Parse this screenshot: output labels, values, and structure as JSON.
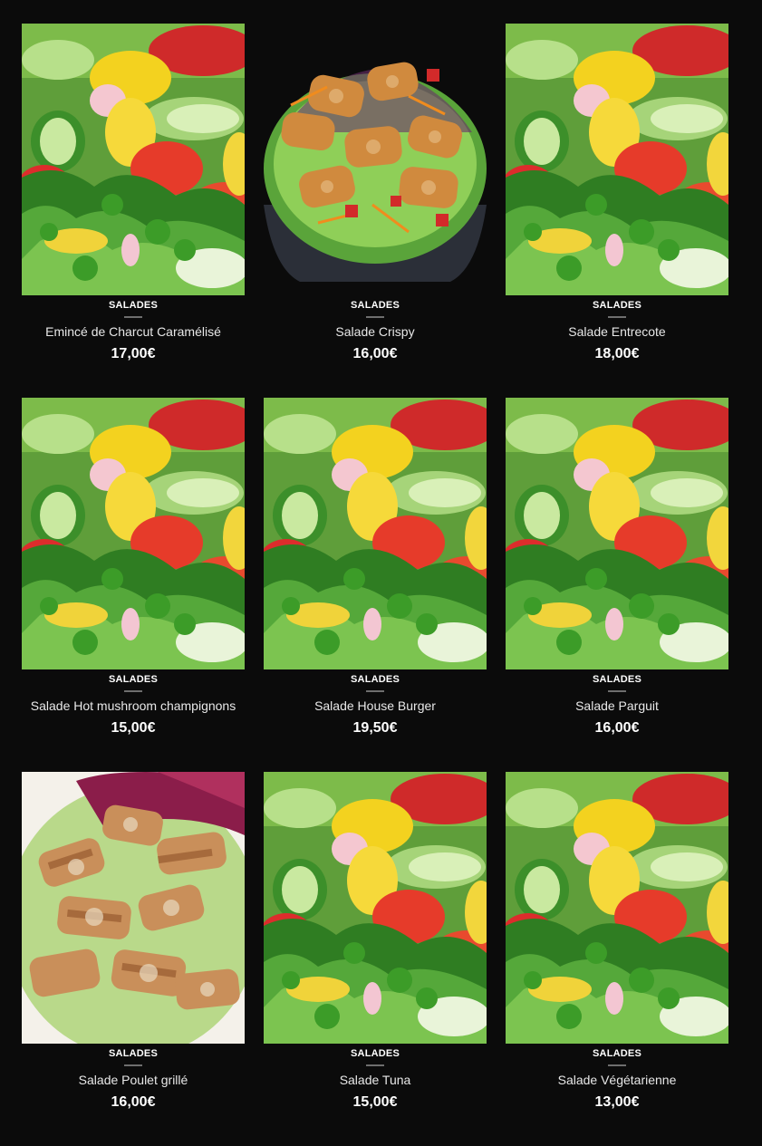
{
  "products": [
    {
      "category": "SALADES",
      "name": "Emincé de Charcut Caramélisé",
      "price": "17,00€",
      "image": "mixed-salad"
    },
    {
      "category": "SALADES",
      "name": "Salade Crispy",
      "price": "16,00€",
      "image": "crispy-chicken-salad"
    },
    {
      "category": "SALADES",
      "name": "Salade Entrecote",
      "price": "18,00€",
      "image": "mixed-salad"
    },
    {
      "category": "SALADES",
      "name": "Salade Hot mushroom champignons",
      "price": "15,00€",
      "image": "mixed-salad"
    },
    {
      "category": "SALADES",
      "name": "Salade House Burger",
      "price": "19,50€",
      "image": "mixed-salad"
    },
    {
      "category": "SALADES",
      "name": "Salade Parguit",
      "price": "16,00€",
      "image": "mixed-salad"
    },
    {
      "category": "SALADES",
      "name": "Salade Poulet grillé",
      "price": "16,00€",
      "image": "grilled-chicken-salad"
    },
    {
      "category": "SALADES",
      "name": "Salade Tuna",
      "price": "15,00€",
      "image": "mixed-salad"
    },
    {
      "category": "SALADES",
      "name": "Salade Végétarienne",
      "price": "13,00€",
      "image": "mixed-salad"
    }
  ],
  "colors": {
    "background": "#0b0b0b",
    "text": "#ffffff",
    "separator": "#6e6e6e"
  }
}
